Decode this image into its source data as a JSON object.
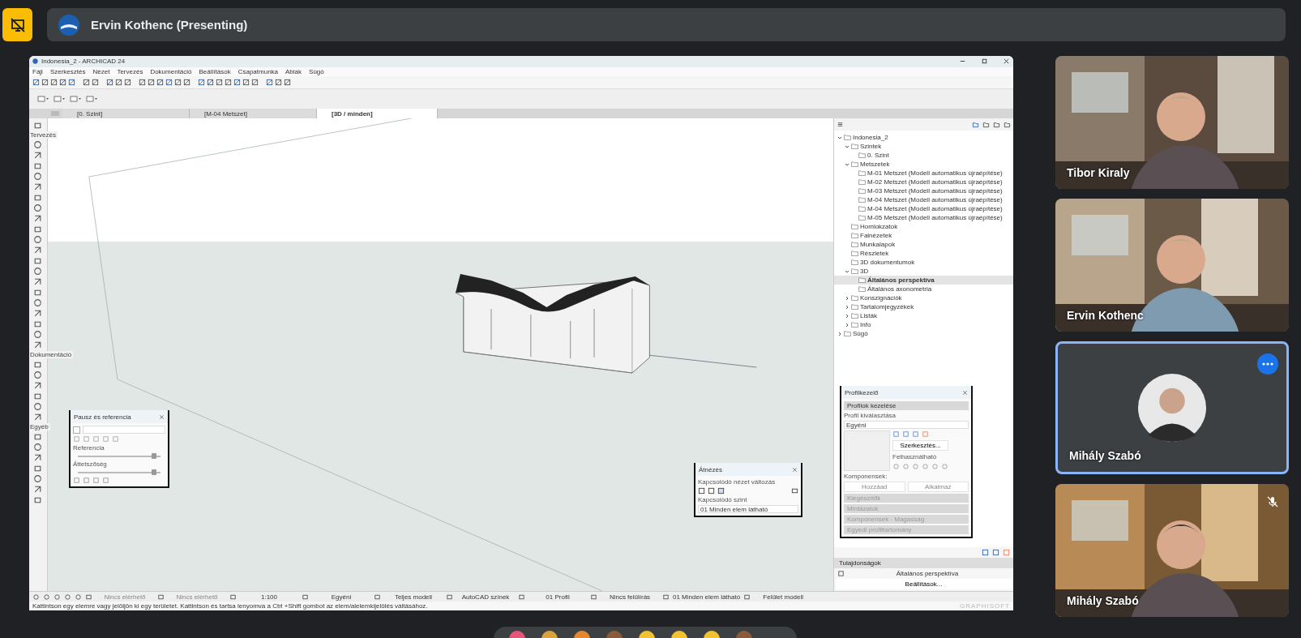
{
  "top_bar": {
    "presenter_label": "Ervin Kothenc (Presenting)"
  },
  "shared_window": {
    "title": "Indonesia_2 - ARCHICAD 24",
    "menu": [
      "Fájl",
      "Szerkesztés",
      "Nézet",
      "Tervezés",
      "Dokumentáció",
      "Beállítások",
      "Csapatmunka",
      "Ablak",
      "Súgó"
    ],
    "tabs": [
      {
        "label": "[0. Szint]",
        "selected": false
      },
      {
        "label": "[M-04 Metszet]",
        "selected": false
      },
      {
        "label": "[3D / minden]",
        "selected": true
      }
    ],
    "toolbox_sections": [
      "Tervezés",
      "Dokumentáció",
      "Egyéb"
    ],
    "navigator": {
      "tree": [
        {
          "label": "Indonesia_2",
          "expanded": true,
          "selected": false,
          "children": [
            {
              "label": "Szintek",
              "expanded": true,
              "selected": false,
              "children": [
                {
                  "label": "0. Szint",
                  "selected": false
                }
              ]
            },
            {
              "label": "Metszetek",
              "expanded": true,
              "selected": false,
              "children": [
                {
                  "label": "M-01 Metszet (Modell automatikus újraépítése)",
                  "selected": false
                },
                {
                  "label": "M-02 Metszet (Modell automatikus újraépítése)",
                  "selected": false
                },
                {
                  "label": "M-03 Metszet (Modell automatikus újraépítése)",
                  "selected": false
                },
                {
                  "label": "M-04 Metszet (Modell automatikus újraépítése)",
                  "selected": false
                },
                {
                  "label": "M-04 Metszet (Modell automatikus újraépítése)",
                  "selected": false
                },
                {
                  "label": "M-05 Metszet (Modell automatikus újraépítése)",
                  "selected": false
                }
              ]
            },
            {
              "label": "Homlokzatok",
              "selected": false
            },
            {
              "label": "Falnézetek",
              "selected": false
            },
            {
              "label": "Munkalapok",
              "selected": false
            },
            {
              "label": "Részletek",
              "selected": false
            },
            {
              "label": "3D dokumentumok",
              "selected": false
            },
            {
              "label": "3D",
              "expanded": true,
              "selected": false,
              "children": [
                {
                  "label": "Általános perspektíva",
                  "selected": true
                },
                {
                  "label": "Általános axonometria",
                  "selected": false
                }
              ]
            },
            {
              "label": "Konszignációk",
              "expanded": false,
              "selected": false
            },
            {
              "label": "Tartalomjegyzékek",
              "expanded": false,
              "selected": false
            },
            {
              "label": "Listák",
              "expanded": false,
              "selected": false
            },
            {
              "label": "Info",
              "expanded": false,
              "selected": false
            }
          ]
        },
        {
          "label": "Súgó",
          "expanded": false,
          "selected": false
        }
      ],
      "properties_title": "Tulajdonságok",
      "properties_value": "Általános perspektíva",
      "settings_button": "Beállítások..."
    },
    "bottom_controls": [
      {
        "value": "Nincs elérhető",
        "disabled": true
      },
      {
        "value": "Nincs elérhető",
        "disabled": true
      },
      {
        "value": "1:100",
        "disabled": false
      },
      {
        "value": "Egyéni",
        "disabled": false
      },
      {
        "value": "Teljes modell",
        "disabled": false
      },
      {
        "value": "AutoCAD színek",
        "disabled": false
      },
      {
        "value": "01 Profil",
        "disabled": false
      },
      {
        "value": "Nincs felülírás",
        "disabled": false
      },
      {
        "value": "01 Minden elem látható",
        "disabled": false
      },
      {
        "value": "Felület modell",
        "disabled": false
      }
    ],
    "status_text": "Kattintson egy elemre vagy jelöljön ki egy területet. Kattintson és tartsa lenyomva a Ctrl +Shift gombot az elem/alelemkijelölés váltásához.",
    "brand": "GRAPHISOFT"
  },
  "trace_palette": {
    "title": "Pausz és referencia",
    "checked": false,
    "sliders": [
      {
        "label": "Referencia",
        "level": 0.92
      },
      {
        "label": "Áttetszőség",
        "level": 0.92
      }
    ]
  },
  "view_palette": {
    "title": "Átnézés",
    "label": "Kapcsolódó nézet változás",
    "sub_label": "Kapcsolódó szint",
    "value": "01 Minden elem látható"
  },
  "profile_palette": {
    "title": "Profilkezelő",
    "section": "Profilok kezelése",
    "select_label": "Profil kiválasztása",
    "select_value": "Egyéni",
    "edit_button": "Szerkesztés...",
    "usable_label": "Felhasználható",
    "components_label": "Komponensek:",
    "add_button": "Hozzáad",
    "apply_button": "Alkalmaz",
    "sections": [
      "Kiegészítők",
      "Mintázatok",
      "Komponensek - Magasság",
      "Egyedi profiltartomány"
    ]
  },
  "participants": [
    {
      "name": "Tibor Kiraly",
      "kind": "video",
      "highlighted": false,
      "muted": false
    },
    {
      "name": "Ervin Kothenc",
      "kind": "video",
      "highlighted": false,
      "muted": false
    },
    {
      "name": "Mihály Szabó",
      "kind": "avatar",
      "highlighted": true,
      "muted": false
    },
    {
      "name": "Mihály Szabó",
      "kind": "video",
      "highlighted": false,
      "muted": true
    }
  ]
}
